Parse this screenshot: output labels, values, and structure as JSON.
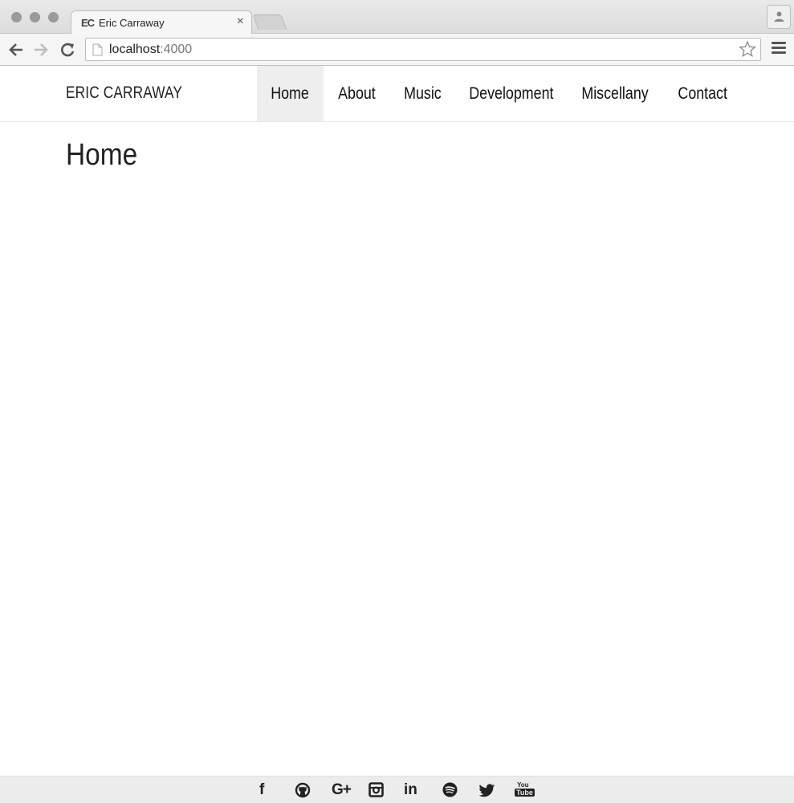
{
  "browser": {
    "tab": {
      "favicon_text": "EC",
      "title": "Eric Carraway",
      "close_glyph": "×"
    },
    "url": {
      "host": "localhost",
      "port": ":4000"
    },
    "icons": [
      "back-icon",
      "forward-icon",
      "reload-icon",
      "page-icon",
      "star-icon",
      "menu-icon",
      "profile-icon"
    ]
  },
  "site": {
    "brand": "ERIC CARRAWAY",
    "nav": [
      {
        "label": "Home",
        "active": true
      },
      {
        "label": "About",
        "active": false
      },
      {
        "label": "Music",
        "active": false
      },
      {
        "label": "Development",
        "active": false
      },
      {
        "label": "Miscellany",
        "active": false
      },
      {
        "label": "Contact",
        "active": false
      }
    ],
    "page_title": "Home"
  },
  "footer": {
    "social": [
      {
        "name": "facebook-icon",
        "glyph": "f"
      },
      {
        "name": "github-icon"
      },
      {
        "name": "google-plus-icon",
        "glyph": "G+"
      },
      {
        "name": "instagram-icon"
      },
      {
        "name": "linkedin-icon",
        "glyph": "in"
      },
      {
        "name": "spotify-icon"
      },
      {
        "name": "twitter-icon"
      },
      {
        "name": "youtube-icon",
        "glyph_top": "You",
        "glyph_bottom": "Tube"
      }
    ]
  },
  "colors": {
    "active_nav_bg": "#eeeeee",
    "footer_bg": "#ececec",
    "text": "#222222"
  }
}
